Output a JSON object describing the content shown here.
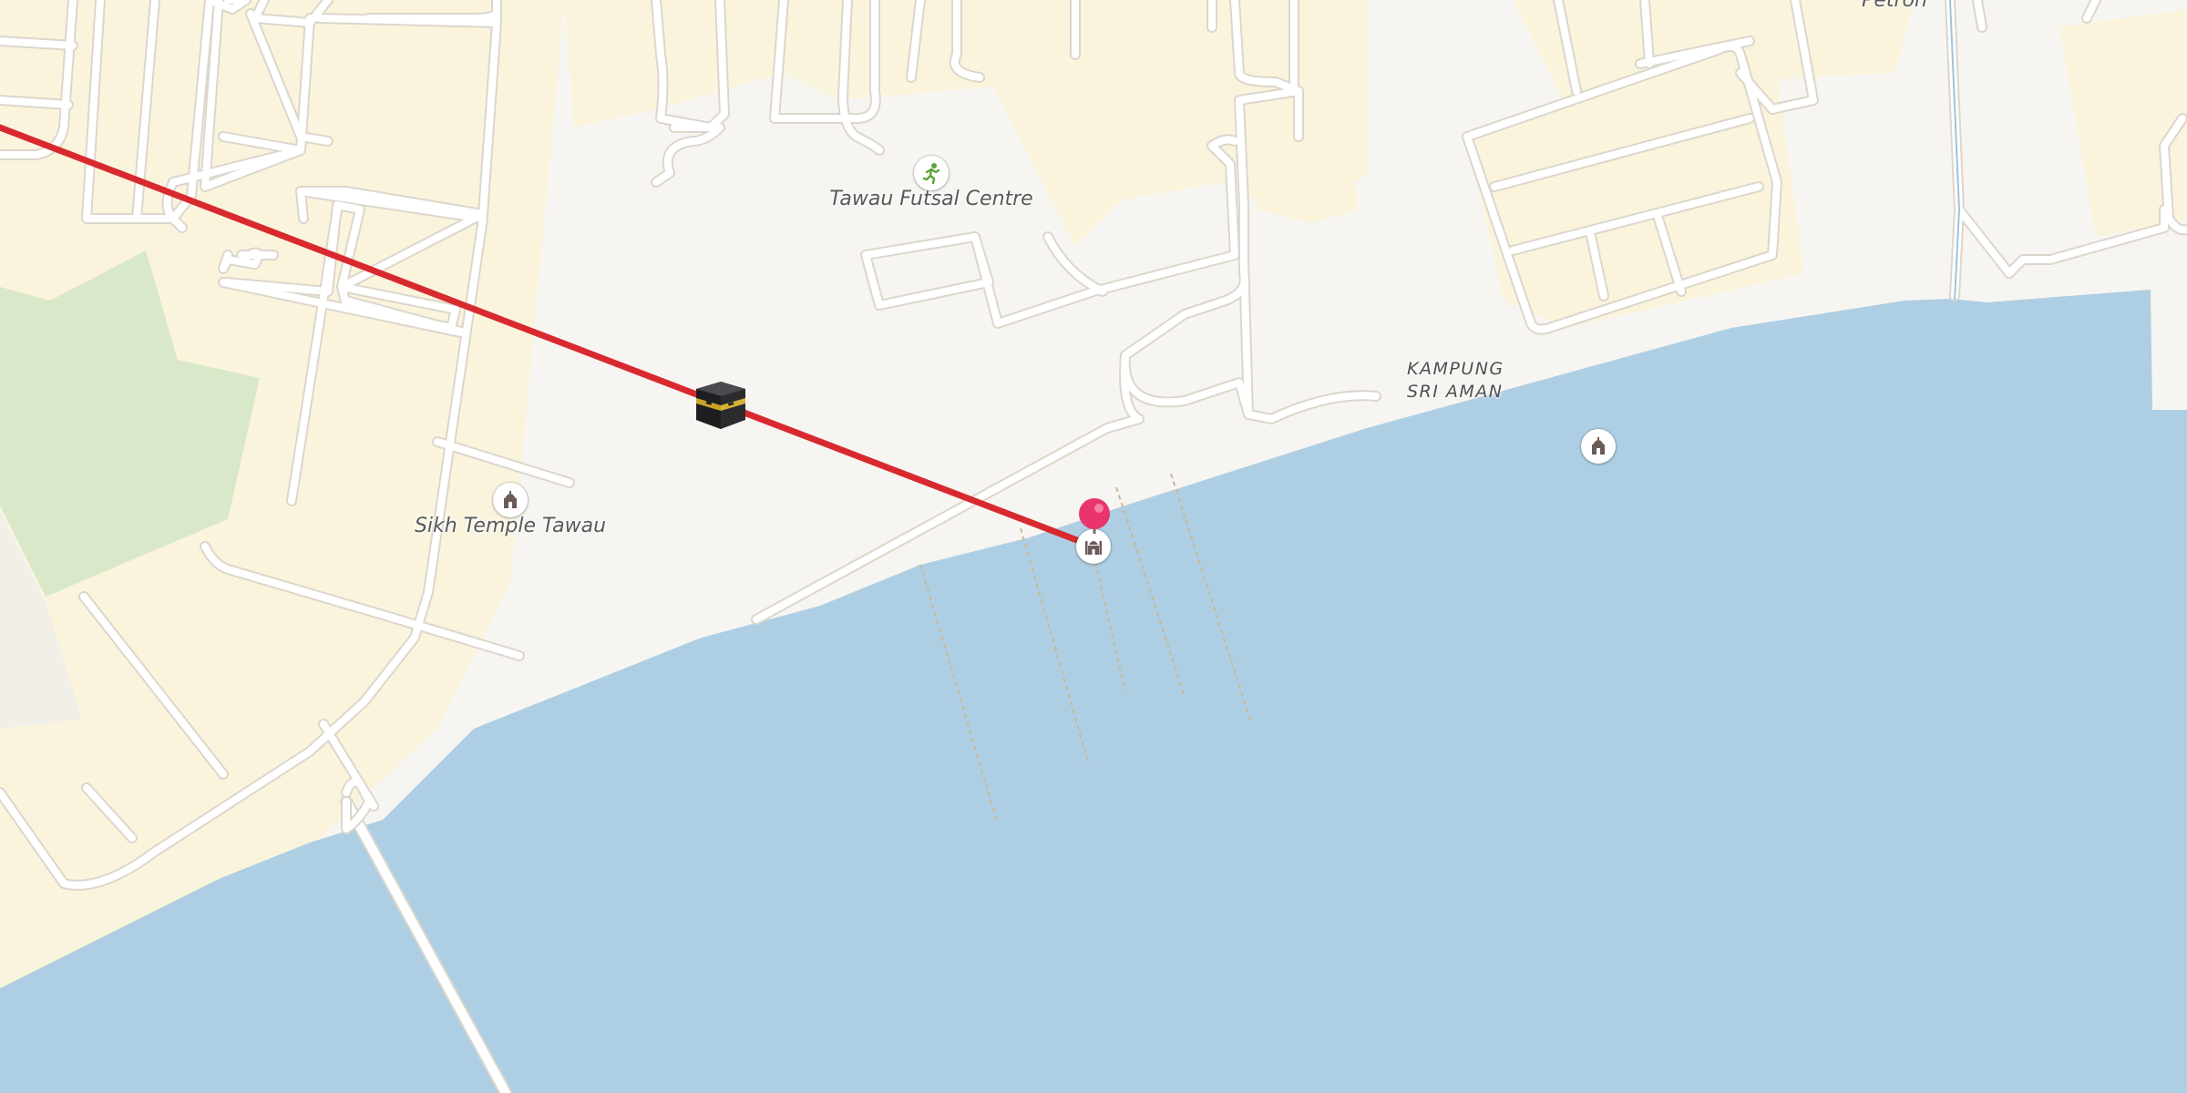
{
  "map": {
    "labels": {
      "futsal": "Tawau Futsal Centre",
      "sikh_temple": "Sikh Temple Tawau",
      "kampung_line1": "KAMPUNG",
      "kampung_line2": "SRI AMAN",
      "petron": "Petron"
    },
    "pois": {
      "futsal_icon": "sports-icon",
      "sikh_temple_icon": "place-of-worship-icon",
      "mosque_icon": "mosque-icon",
      "kampung_icon": "place-of-worship-icon"
    },
    "markers": {
      "kaaba": "kaaba-marker",
      "pin": "location-pin"
    },
    "colors": {
      "water": "#aecfe3",
      "land": "#f7f5f1",
      "residential": "#fbf4dd",
      "park": "#d9e8c8",
      "road": "#ffffff",
      "road_casing": "#dcd6cc",
      "qibla_line": "#d8292f",
      "pin": "#e8356d"
    }
  }
}
